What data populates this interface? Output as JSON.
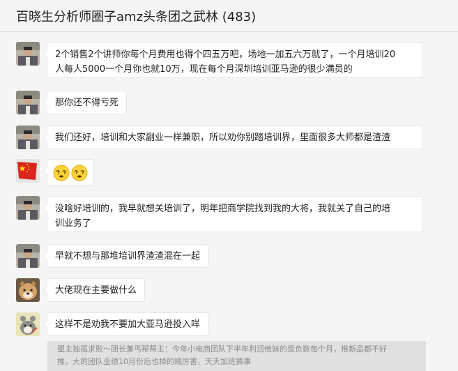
{
  "header": {
    "title": "百晓生分析师圈子amz头条团之武林 (483)"
  },
  "messages": [
    {
      "avatar": "user-photo-avatar",
      "line1": "2个销售2个讲师你每个月费用也得个四五万吧，场地一加五六万就了，一个月培训20",
      "line2": "人每人5000一个月你也就10万，现在每个月深圳培训亚马逊的很少满员的"
    },
    {
      "avatar": "user-photo-avatar",
      "line1": "那你还不得亏死"
    },
    {
      "avatar": "user-photo-avatar",
      "line1": "我们还好，培训和大家副业一样兼职，所以劝你别踏培训界，里面很多大师都是渣渣"
    },
    {
      "avatar": "flag-avatar",
      "emojis": [
        "dizzy-face-emoji",
        "dizzy-face-emoji"
      ]
    },
    {
      "avatar": "user-photo-avatar",
      "line1": "没啥好培训的，我早就想关培训了，明年把商学院找到我的大将，我就关了自己的培",
      "line2": "训业务了"
    },
    {
      "avatar": "user-photo-avatar",
      "line1": "早就不想与那堆培训界渣渣混在一起"
    },
    {
      "avatar": "dog-avatar",
      "line1": "大佬现在主要做什么"
    },
    {
      "avatar": "cartoon-avatar",
      "line1": "这样不是劝我不要加大亚马逊投入咩"
    }
  ],
  "notice": {
    "line1": "盟主独孤求败～团长兼丐帮帮主：今年小电商团队下半年利润他妹的是负数每个月，推新品都不好",
    "line2": "推，大的团队业绩10月份后也掉的贼厉害，天天加班搞事"
  },
  "colors": {
    "background": "#f5f5f5",
    "bubble": "#ffffff",
    "bubble_border": "#e6e6e6",
    "notice_bg": "#e0e0e0",
    "notice_text": "#8a8a8a"
  }
}
